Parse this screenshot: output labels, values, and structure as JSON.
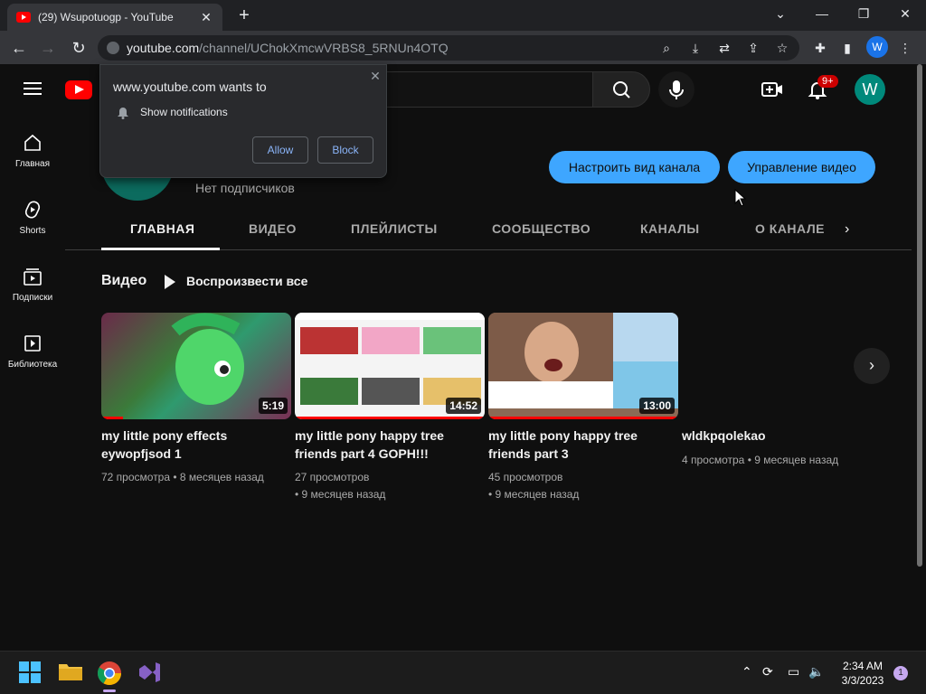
{
  "browser": {
    "tab_title": "(29) Wsupotuogp - YouTube",
    "url_host": "youtube.com",
    "url_path": "/channel/UChokXmcwVRBS8_5RNUn4OTQ",
    "profile_letter": "W"
  },
  "masthead": {
    "notif_badge": "9+",
    "avatar_letter": "W"
  },
  "sidebar": {
    "items": [
      {
        "label": "Главная",
        "icon": "home-icon"
      },
      {
        "label": "Shorts",
        "icon": "shorts-icon"
      },
      {
        "label": "Подписки",
        "icon": "subscriptions-icon"
      },
      {
        "label": "Библиотека",
        "icon": "library-icon"
      }
    ]
  },
  "channel": {
    "subscribers": "Нет подписчиков",
    "customize_label": "Настроить вид канала",
    "manage_label": "Управление видео",
    "tabs": [
      "ГЛАВНАЯ",
      "ВИДЕО",
      "ПЛЕЙЛИСТЫ",
      "СООБЩЕСТВО",
      "КАНАЛЫ",
      "О КАНАЛЕ"
    ]
  },
  "shelf": {
    "title": "Видео",
    "play_all": "Воспроизвести все",
    "videos": [
      {
        "title": "my little pony effects eywopfjsod 1",
        "duration": "5:19",
        "meta1": "72 просмотра • 8 месяцев назад",
        "meta2": ""
      },
      {
        "title": "my little pony happy tree friends part 4 GOPH!!!",
        "duration": "14:52",
        "meta1": "27 просмотров",
        "meta2": "• 9 месяцев назад"
      },
      {
        "title": "my little pony happy tree friends part 3",
        "duration": "13:00",
        "meta1": "45 просмотров",
        "meta2": "• 9 месяцев назад"
      },
      {
        "title": "wldkpqolekao",
        "duration": "",
        "meta1": "4 просмотра • 9 месяцев назад",
        "meta2": ""
      }
    ]
  },
  "popup": {
    "title": "www.youtube.com wants to",
    "message": "Show notifications",
    "allow": "Allow",
    "block": "Block"
  },
  "taskbar": {
    "time": "2:34 AM",
    "date": "3/3/2023",
    "notif_count": "1"
  }
}
